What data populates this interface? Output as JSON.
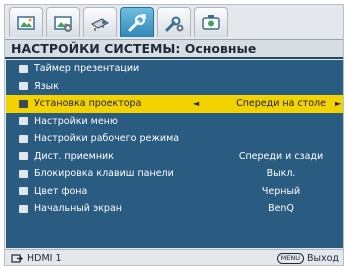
{
  "tabs": [
    {
      "icon": "picture-icon"
    },
    {
      "icon": "picture-advanced-icon"
    },
    {
      "icon": "display-icon"
    },
    {
      "icon": "system-setup-basic-icon"
    },
    {
      "icon": "system-setup-advanced-icon"
    },
    {
      "icon": "information-icon"
    }
  ],
  "header": {
    "title": "НАСТРОЙКИ СИСТЕМЫ: Основные"
  },
  "menu": {
    "items": [
      {
        "label": "Таймер презентации",
        "value": ""
      },
      {
        "label": "Язык",
        "value": ""
      },
      {
        "label": "Установка проектора",
        "value": "Спереди на столе"
      },
      {
        "label": "Настройки меню",
        "value": ""
      },
      {
        "label": "Настройки рабочего режима",
        "value": ""
      },
      {
        "label": "Дист. приемник",
        "value": "Спереди и сзади"
      },
      {
        "label": "Блокировка клавиш панели",
        "value": "Выкл."
      },
      {
        "label": "Цвет фона",
        "value": "Черный"
      },
      {
        "label": "Начальный экран",
        "value": "BenQ"
      }
    ],
    "selected_index": 2,
    "left_arrow": "◄",
    "right_arrow": "►"
  },
  "footer": {
    "source": "HDMI 1",
    "menu_key": "MENU",
    "exit_label": "Выход"
  },
  "colors": {
    "panel": "#2a5b80",
    "highlight": "#f2d200",
    "active_tab": "#2f87b8"
  }
}
